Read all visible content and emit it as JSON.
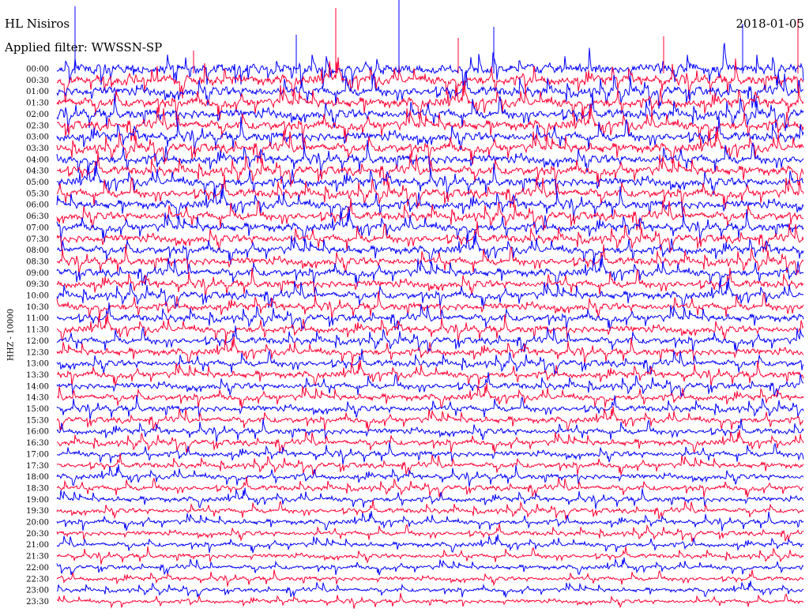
{
  "header": {
    "station": "HL Nisiros",
    "date": "2018-01-05",
    "filter_text": "Applied filter: WWSSN-SP"
  },
  "chart_data": {
    "type": "helicorder",
    "ylabel": "HHZ - 10000",
    "colors": [
      "#0000ff",
      "#ff0033"
    ],
    "tick_labels": [
      "00:00",
      "00:30",
      "01:00",
      "01:30",
      "02:00",
      "02:30",
      "03:00",
      "03:30",
      "04:00",
      "04:30",
      "05:00",
      "05:30",
      "06:00",
      "06:30",
      "07:00",
      "07:30",
      "08:00",
      "08:30",
      "09:00",
      "09:30",
      "10:00",
      "10:30",
      "11:00",
      "11:30",
      "12:00",
      "12:30",
      "13:00",
      "13:30",
      "14:00",
      "14:30",
      "15:00",
      "15:30",
      "16:00",
      "16:30",
      "17:00",
      "17:30",
      "18:00",
      "18:30",
      "19:00",
      "19:30",
      "20:00",
      "20:30",
      "21:00",
      "21:30",
      "22:00",
      "22:30",
      "23:00",
      "23:30"
    ]
  }
}
